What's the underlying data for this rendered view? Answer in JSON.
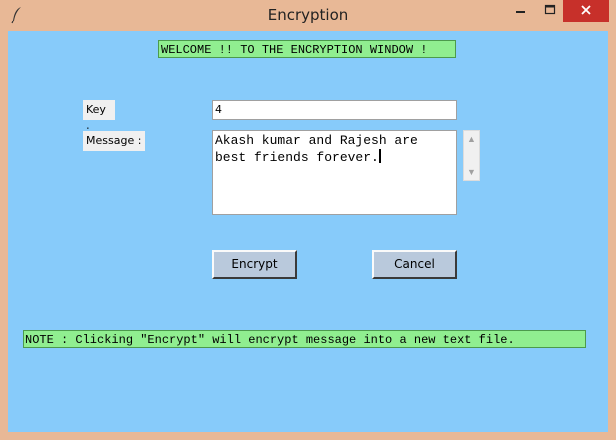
{
  "window": {
    "title": "Encryption",
    "icon": "feather-icon",
    "controls": [
      "minimize-icon",
      "maximize-icon",
      "close-icon"
    ],
    "close_color": "#c7302a"
  },
  "colors": {
    "client_background": "#87cbfa",
    "banner_background": "#90ee90",
    "titlebar": "#e8b896"
  },
  "welcome": "WELCOME !! TO THE ENCRYPTION WINDOW !",
  "form": {
    "key_label": "Key :",
    "key_value": "4",
    "message_label": "Message :",
    "message_value": "Akash kumar and Rajesh are best friends forever."
  },
  "buttons": {
    "encrypt": "Encrypt",
    "cancel": "Cancel"
  },
  "note": "NOTE : Clicking \"Encrypt\" will encrypt message into a new text file."
}
